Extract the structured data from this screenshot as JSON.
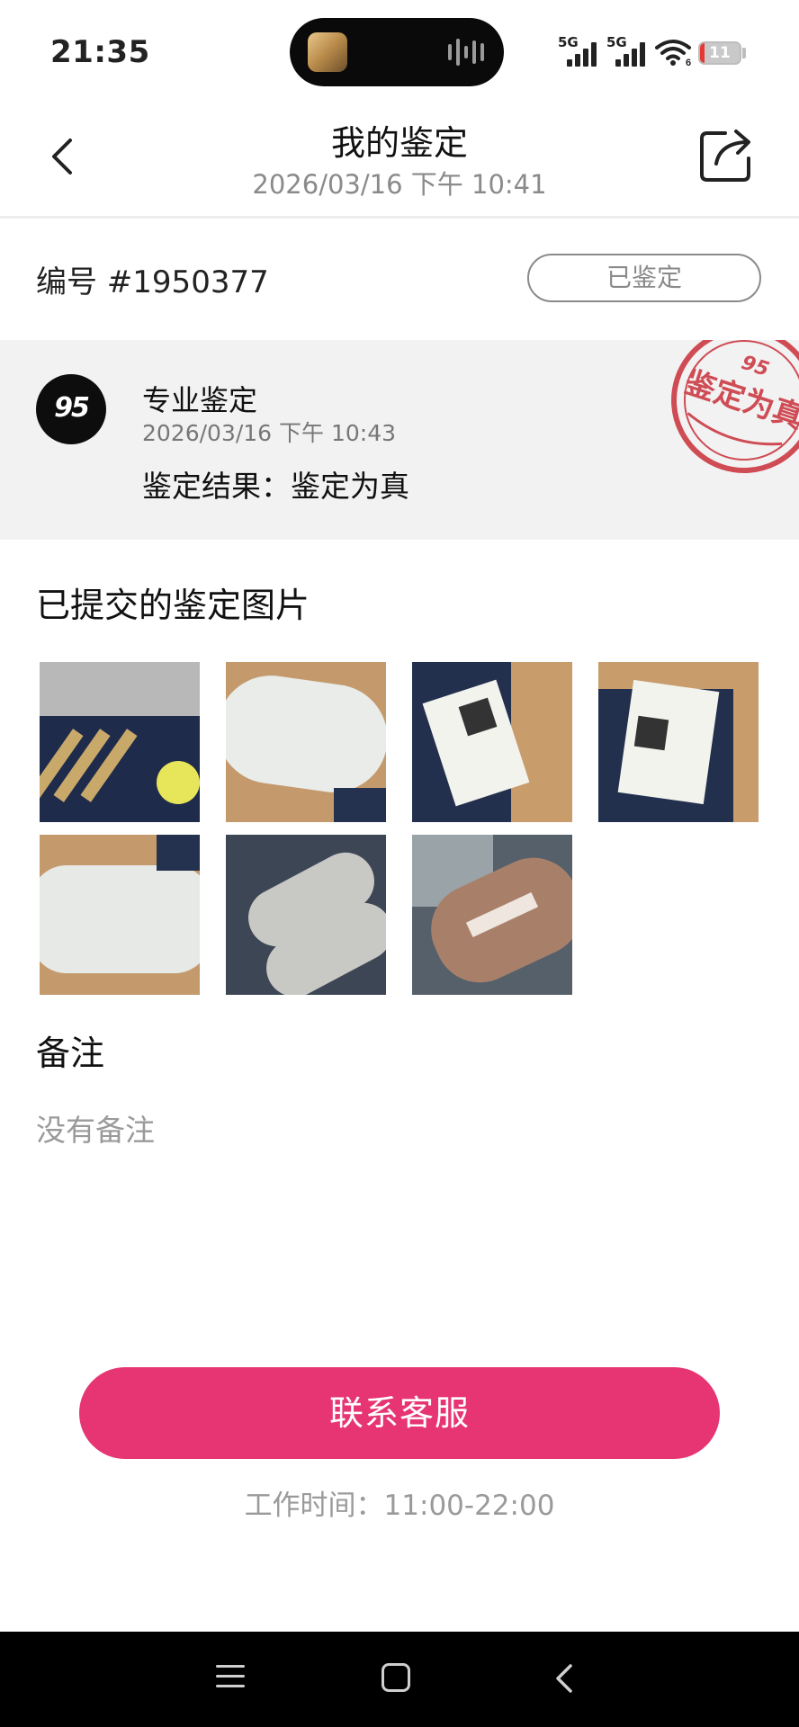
{
  "status_bar": {
    "time": "21:35",
    "signal_1": "5G",
    "signal_2": "5G",
    "wifi_label": "6",
    "battery": "11",
    "battery_level_percent": 11
  },
  "header": {
    "title": "我的鉴定",
    "datetime": "2026/03/16 下午 10:41",
    "back_icon": "chevron-left-icon",
    "share_icon": "share-icon"
  },
  "order": {
    "number": "编号 #1950377",
    "status": "已鉴定"
  },
  "result": {
    "logo_text": "95",
    "type": "专业鉴定",
    "datetime": "2026/03/16 下午 10:43",
    "text": "鉴定结果：鉴定为真",
    "stamp_text": "鉴定为真",
    "stamp_logo": "95",
    "stamp_color": "#c9303a"
  },
  "images": {
    "title": "已提交的鉴定图片",
    "count": 7
  },
  "notes": {
    "title": "备注",
    "text": "没有备注"
  },
  "cta": {
    "label": "联系客服",
    "color": "#e63572"
  },
  "hours": "工作时间：11:00-22:00",
  "nav": {
    "icons": [
      "menu-icon",
      "home-square-icon",
      "back-triangle-icon"
    ]
  }
}
